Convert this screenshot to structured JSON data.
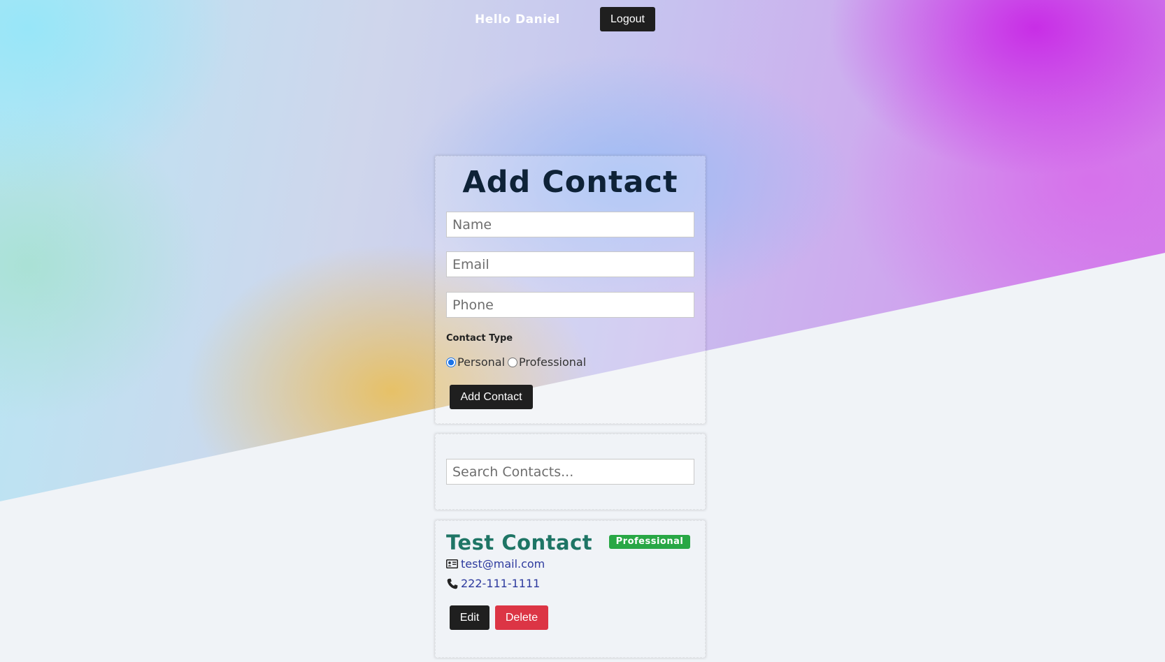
{
  "header": {
    "greeting": "Hello Daniel",
    "logout_label": "Logout"
  },
  "form": {
    "title": "Add Contact",
    "name_placeholder": "Name",
    "email_placeholder": "Email",
    "phone_placeholder": "Phone",
    "type_label": "Contact Type",
    "type_options": [
      "Personal",
      "Professional"
    ],
    "type_selected": "Personal",
    "submit_label": "Add Contact"
  },
  "search": {
    "placeholder": "Search Contacts..."
  },
  "contacts": [
    {
      "name": "Test Contact",
      "type": "Professional",
      "email": "test@mail.com",
      "phone": "222-111-1111",
      "edit_label": "Edit",
      "delete_label": "Delete"
    }
  ],
  "colors": {
    "dark_button": "#1f1f1f",
    "danger": "#dc3545",
    "success_badge": "#28a745",
    "contact_name": "#1e7565",
    "link": "#2d3a9e",
    "title": "#0e2237"
  },
  "icons": {
    "email": "id-card-icon",
    "phone": "phone-icon"
  }
}
